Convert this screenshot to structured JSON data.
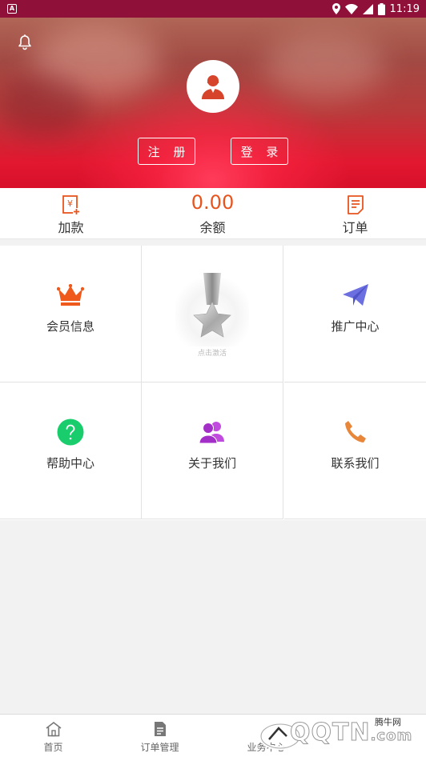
{
  "status_bar": {
    "time": "11:19",
    "left_icon": "A"
  },
  "header": {
    "register_label": "注 册",
    "login_label": "登 录"
  },
  "stats": {
    "deposit_label": "加款",
    "balance_value": "0.00",
    "balance_label": "余额",
    "orders_label": "订单"
  },
  "grid": {
    "member_info": "会员信息",
    "medal_caption": "点击激活",
    "promo_center": "推广中心",
    "help_center": "帮助中心",
    "about_us": "关于我们",
    "contact_us": "联系我们"
  },
  "tabbar": {
    "home": "首页",
    "order_mgmt": "订单管理",
    "business": "业务中心"
  },
  "watermark": {
    "brand": "QQTN",
    "suffix": ".com",
    "site": "腾牛网"
  },
  "colors": {
    "accent": "#e8541e",
    "status_bar": "#8f1038",
    "crown": "#ef5a1c",
    "plane": "#6b6fe0",
    "help": "#19cc6c",
    "about": "#b43bd6",
    "phone": "#e8863a"
  },
  "icons": [
    "bell-icon",
    "avatar-icon",
    "deposit-icon",
    "orders-icon",
    "crown-icon",
    "medal-icon",
    "paper-plane-icon",
    "help-icon",
    "users-icon",
    "phone-icon",
    "home-icon",
    "document-icon"
  ]
}
